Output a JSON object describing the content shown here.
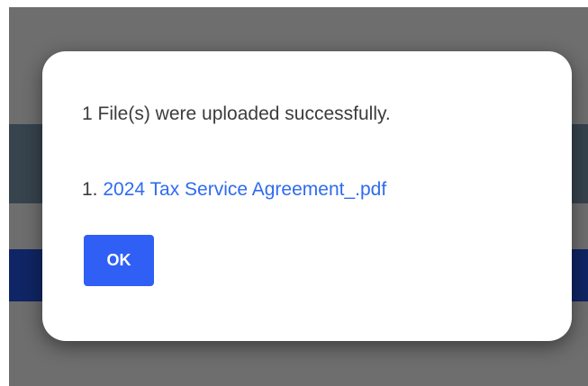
{
  "dialog": {
    "message": "1 File(s) were uploaded successfully.",
    "files": [
      {
        "index": "1.",
        "name": "2024 Tax Service Agreement_.pdf"
      }
    ],
    "ok_label": "OK"
  },
  "colors": {
    "backdrop": "#6e6e6e",
    "band_dark": "#37434d",
    "band_blue": "#102565",
    "link": "#2f6bf0",
    "button": "#2f5ff5"
  }
}
